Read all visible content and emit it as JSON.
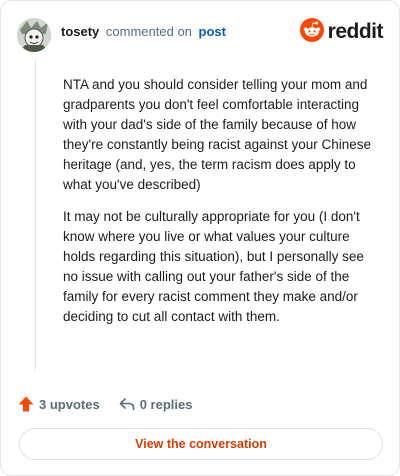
{
  "comment": {
    "author": "tosety",
    "verb": "commented on",
    "target": "post",
    "paragraphs": [
      "NTA and you should consider telling your mom and gradparents you don't feel comfortable interacting with your dad's side of the family because of how they're constantly being racist against your Chinese heritage (and, yes, the term racism does apply to what you've described)",
      "It may not be culturally appropriate for you (I don't know where you live or what values your culture holds regarding this situation), but I personally see no issue with calling out your father's side of the family for every racist comment they make and/or deciding to cut all contact with them."
    ]
  },
  "brand": {
    "name": "reddit",
    "icon": "reddit-logo-icon",
    "color": "#ff4500"
  },
  "stats": {
    "upvotes": "3 upvotes",
    "replies": "0 replies",
    "upvote_icon": "upvote-arrow-icon",
    "reply_icon": "reply-arrow-icon",
    "upvote_color": "#ff4500"
  },
  "cta": {
    "label": "View the conversation",
    "color": "#d93a00"
  }
}
